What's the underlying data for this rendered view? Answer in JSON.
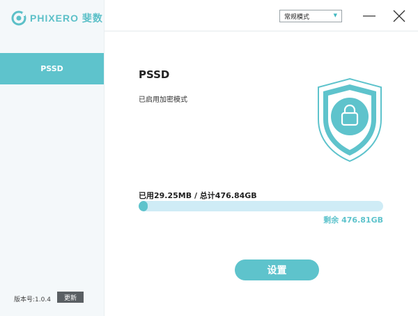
{
  "app": {
    "logo_text": "PHIXERO 斐数",
    "version_label": "版本号:1.0.4",
    "update_label": "更新"
  },
  "sidebar": {
    "items": [
      {
        "label": "PSSD",
        "active": true
      }
    ]
  },
  "header": {
    "mode_select": {
      "value": "常规模式",
      "icon": "chevron-down-icon"
    },
    "window_controls": [
      "minimize-icon",
      "close-icon"
    ]
  },
  "device": {
    "name": "PSSD",
    "status": "已启用加密模式",
    "shield_icon": "shield-lock-icon"
  },
  "storage": {
    "usage_text": "已用29.25MB / 总计476.84GB",
    "remaining_text": "剩余 476.81GB",
    "used_fraction": 6e-05
  },
  "actions": {
    "settings_label": "设置"
  },
  "colors": {
    "accent": "#5ec3cc",
    "track": "#cfecf6",
    "sidebar_bg": "#f4f8fa",
    "update_button": "#5a5f63"
  }
}
